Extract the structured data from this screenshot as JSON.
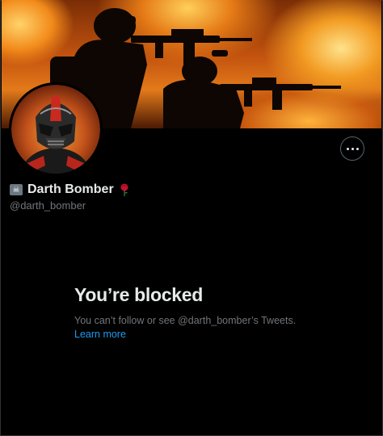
{
  "profile": {
    "display_name": "Darth Bomber",
    "handle": "@darth_bomber",
    "name_prefix_icon": "pirate-flag-icon",
    "name_suffix_icon": "rose-icon"
  },
  "actions": {
    "more_icon": "more-horizontal-icon"
  },
  "blocked": {
    "title": "You’re blocked",
    "description": "You can’t follow or see @darth_bomber’s Tweets.",
    "learn_more": "Learn more"
  },
  "colors": {
    "background": "#000000",
    "text_primary": "#e7e9ea",
    "text_secondary": "#71767b",
    "link": "#1d9bf0"
  }
}
